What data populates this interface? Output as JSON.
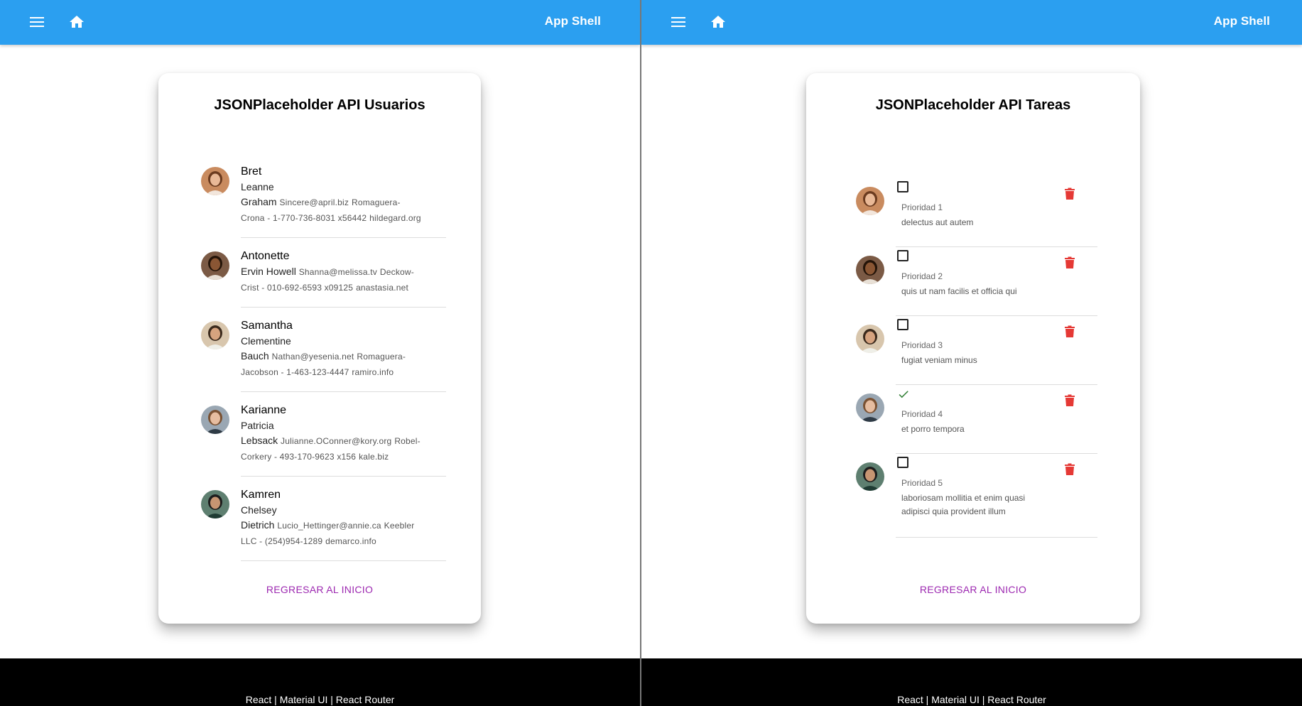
{
  "left": {
    "appbar": {
      "title": "App Shell"
    },
    "card": {
      "title": "JSONPlaceholder API Usuarios",
      "back_link": "REGRESAR AL INICIO"
    },
    "users": [
      {
        "username": "Bret",
        "name_line1": "Leanne",
        "name_line2": "Graham",
        "email": "Sincere@april.biz",
        "company_part1": "Romaguera-",
        "company_part2": "Crona",
        "phone": "1-770-736-8031 x56442",
        "website": "hildegard.org"
      },
      {
        "username": "Antonette",
        "name_line1": "Ervin Howell",
        "name_line2": "",
        "email": "Shanna@melissa.tv",
        "company_part1": "Deckow-",
        "company_part2": "Crist",
        "phone": "010-692-6593 x09125",
        "website": "anastasia.net"
      },
      {
        "username": "Samantha",
        "name_line1": "Clementine",
        "name_line2": "Bauch",
        "email": "Nathan@yesenia.net",
        "company_part1": "Romaguera-",
        "company_part2": "Jacobson",
        "phone": "1-463-123-4447",
        "website": "ramiro.info"
      },
      {
        "username": "Karianne",
        "name_line1": "Patricia",
        "name_line2": "Lebsack",
        "email": "Julianne.OConner@kory.org",
        "company_part1": "Robel-",
        "company_part2": "Corkery",
        "phone": "493-170-9623 x156",
        "website": "kale.biz"
      },
      {
        "username": "Kamren",
        "name_line1": "Chelsey",
        "name_line2": "Dietrich",
        "email": "Lucio_Hettinger@annie.ca",
        "company_part1": "Keebler",
        "company_part2": "LLC",
        "phone": "(254)954-1289",
        "website": "demarco.info"
      }
    ],
    "footer": "React | Material UI | React Router"
  },
  "right": {
    "appbar": {
      "title": "App Shell"
    },
    "card": {
      "title": "JSONPlaceholder API Tareas",
      "back_link": "REGRESAR AL INICIO"
    },
    "tasks": [
      {
        "priority": "Prioridad 1",
        "title": "delectus aut autem",
        "completed": false
      },
      {
        "priority": "Prioridad 2",
        "title": "quis ut nam facilis et officia qui",
        "completed": false
      },
      {
        "priority": "Prioridad 3",
        "title": "fugiat veniam minus",
        "completed": false
      },
      {
        "priority": "Prioridad 4",
        "title": "et porro tempora",
        "completed": true
      },
      {
        "priority": "Prioridad 5",
        "title": "laboriosam mollitia et enim quasi adipisci quia provident illum",
        "completed": false
      }
    ],
    "footer": "React | Material UI | React Router"
  },
  "colors": {
    "appbar": "#2b9ff0",
    "link": "#9c27b0",
    "delete": "#e53935",
    "check": "#2e7d32",
    "footer": "#000000"
  },
  "icons": [
    "menu-icon",
    "home-icon",
    "checkbox-empty-icon",
    "check-icon",
    "trash-icon"
  ]
}
